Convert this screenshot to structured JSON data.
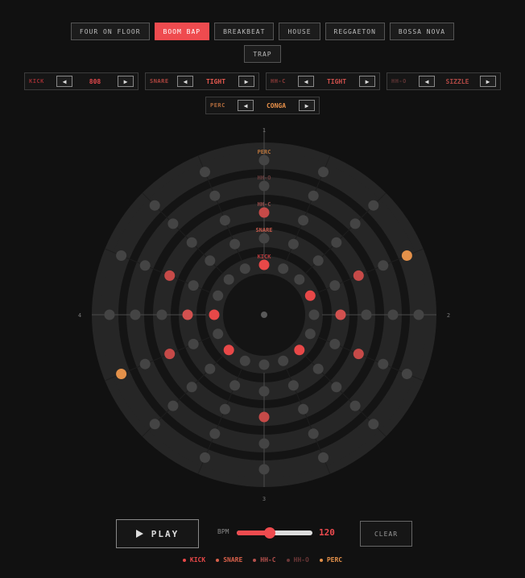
{
  "presets": {
    "row1": [
      {
        "label": "FOUR ON FLOOR",
        "active": false
      },
      {
        "label": "BOOM BAP",
        "active": true
      },
      {
        "label": "BREAKBEAT",
        "active": false
      },
      {
        "label": "HOUSE",
        "active": false
      },
      {
        "label": "REGGAETON",
        "active": false
      },
      {
        "label": "BOSSA NOVA",
        "active": false
      }
    ],
    "row2": [
      {
        "label": "TRAP",
        "active": false
      }
    ]
  },
  "sounds": {
    "row1": [
      {
        "track": "KICK",
        "value": "808",
        "label_color": "#9a2e32",
        "value_color": "#e4484c"
      },
      {
        "track": "SNARE",
        "value": "TIGHT",
        "label_color": "#b0453f",
        "value_color": "#e4584e"
      },
      {
        "track": "HH-C",
        "value": "TIGHT",
        "label_color": "#8a3a38",
        "value_color": "#d0504c"
      },
      {
        "track": "HH-O",
        "value": "SIZZLE",
        "label_color": "#5e3434",
        "value_color": "#b04844"
      }
    ],
    "row2": [
      {
        "track": "PERC",
        "value": "CONGA",
        "label_color": "#b06a3c",
        "value_color": "#e8914a"
      }
    ],
    "prev_glyph": "◀",
    "next_glyph": "▶"
  },
  "wheel": {
    "step_labels": [
      "1",
      "2",
      "3",
      "4"
    ],
    "rings": [
      {
        "name": "KICK",
        "color": "#e84848",
        "label_color": "#b83a3c",
        "active": [
          0,
          3,
          6,
          10,
          12
        ]
      },
      {
        "name": "SNARE",
        "color": "#d2514f",
        "label_color": "#c45a4c",
        "active": [
          4,
          12
        ]
      },
      {
        "name": "HH-C",
        "color": "#c64a48",
        "label_color": "#944a48",
        "active": [
          0,
          3,
          5,
          8,
          11,
          13
        ]
      },
      {
        "name": "HH-O",
        "color": "#7a3a3a",
        "label_color": "#663a3a",
        "active": []
      },
      {
        "name": "PERC",
        "color": "#e4914a",
        "label_color": "#b8743c",
        "active": [
          3,
          11
        ]
      }
    ]
  },
  "controls": {
    "play_label": "PLAY",
    "bpm_label": "BPM",
    "bpm_value": "120",
    "bpm_fraction": 0.44,
    "clear_label": "CLEAR"
  },
  "legend": [
    {
      "label": "KICK",
      "color": "#e84848"
    },
    {
      "label": "SNARE",
      "color": "#d8604a"
    },
    {
      "label": "HH-C",
      "color": "#b4504c"
    },
    {
      "label": "HH-O",
      "color": "#6a3636"
    },
    {
      "label": "PERC",
      "color": "#e4914a"
    }
  ]
}
